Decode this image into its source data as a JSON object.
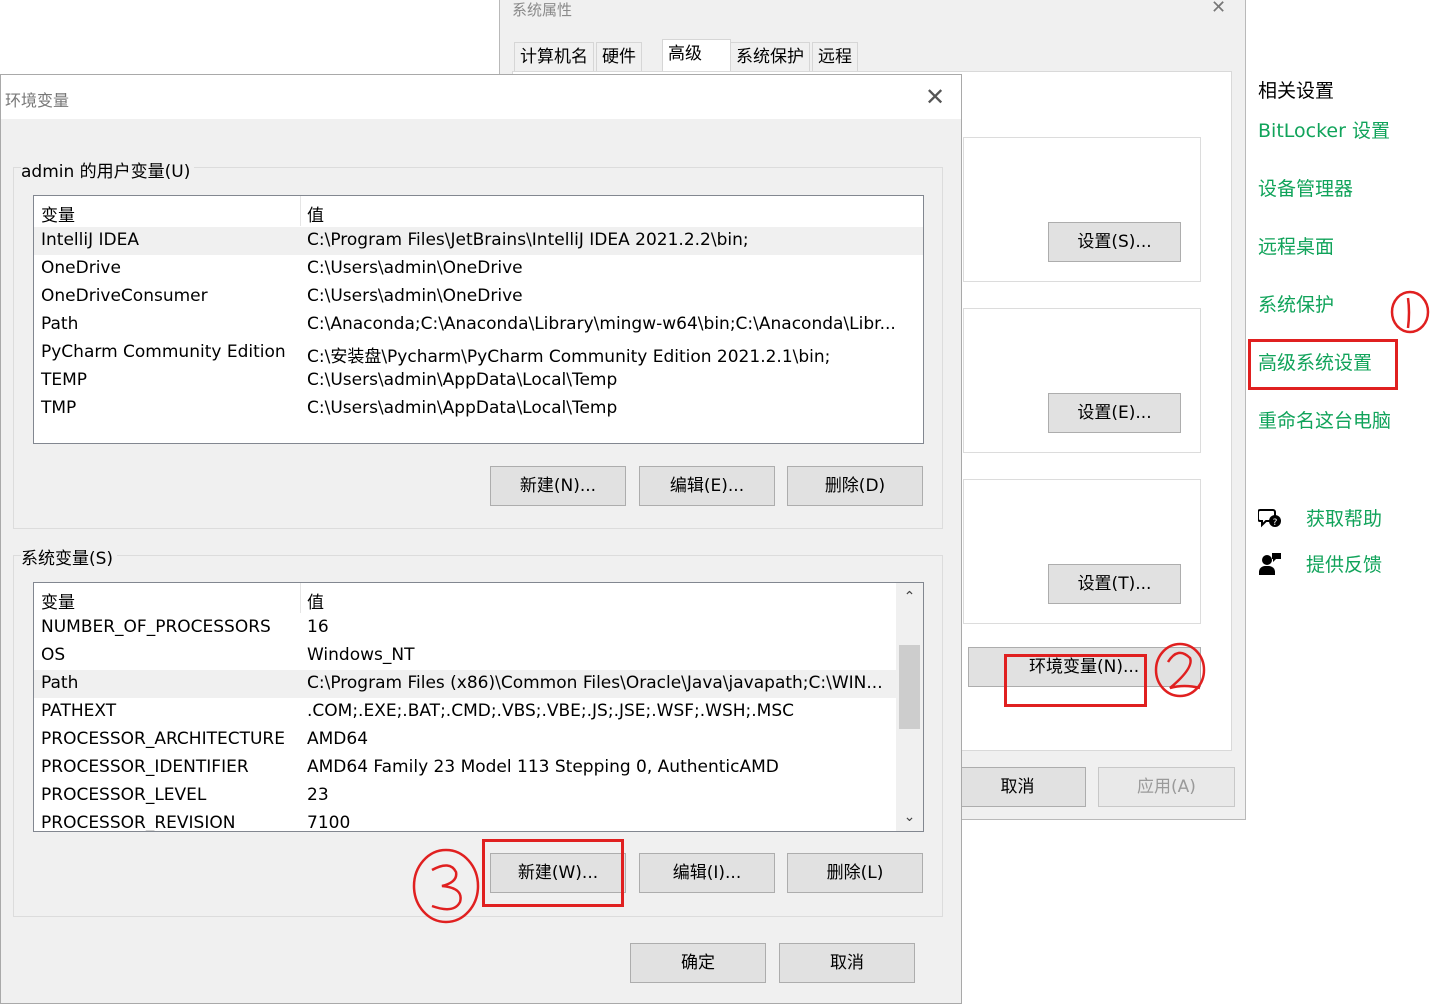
{
  "settings_panel": {
    "title": "相关设置",
    "links": [
      "BitLocker 设置",
      "设备管理器",
      "远程桌面",
      "系统保护",
      "高级系统设置",
      "重命名这台电脑"
    ],
    "help": [
      {
        "label": "获取帮助",
        "icon": "chat-help-icon"
      },
      {
        "label": "提供反馈",
        "icon": "feedback-person-icon"
      }
    ],
    "link_color": "#10a35a"
  },
  "system_properties": {
    "title": "系统属性",
    "tabs": [
      "计算机名",
      "硬件",
      "高级",
      "系统保护",
      "远程"
    ],
    "active_tab": "高级",
    "buttons": {
      "performance_settings": "设置(S)...",
      "profile_settings": "设置(E)...",
      "startup_settings": "设置(T)...",
      "env_vars": "环境变量(N)...",
      "cancel": "取消",
      "apply": "应用(A)"
    }
  },
  "env_dialog": {
    "title": "环境变量",
    "user_section": {
      "legend": "admin 的用户变量(U)",
      "columns": [
        "变量",
        "值"
      ],
      "rows": [
        {
          "name": "IntelliJ IDEA",
          "value": "C:\\Program Files\\JetBrains\\IntelliJ IDEA 2021.2.2\\bin;"
        },
        {
          "name": "OneDrive",
          "value": "C:\\Users\\admin\\OneDrive"
        },
        {
          "name": "OneDriveConsumer",
          "value": "C:\\Users\\admin\\OneDrive"
        },
        {
          "name": "Path",
          "value": "C:\\Anaconda;C:\\Anaconda\\Library\\mingw-w64\\bin;C:\\Anaconda\\Libr..."
        },
        {
          "name": "PyCharm Community Edition",
          "value": "C:\\安装盘\\Pycharm\\PyCharm Community Edition 2021.2.1\\bin;"
        },
        {
          "name": "TEMP",
          "value": "C:\\Users\\admin\\AppData\\Local\\Temp"
        },
        {
          "name": "TMP",
          "value": "C:\\Users\\admin\\AppData\\Local\\Temp"
        }
      ],
      "buttons": {
        "new": "新建(N)...",
        "edit": "编辑(E)...",
        "delete": "删除(D)"
      }
    },
    "system_section": {
      "legend": "系统变量(S)",
      "columns": [
        "变量",
        "值"
      ],
      "rows": [
        {
          "name": "NUMBER_OF_PROCESSORS",
          "value": "16"
        },
        {
          "name": "OS",
          "value": "Windows_NT"
        },
        {
          "name": "Path",
          "value": "C:\\Program Files (x86)\\Common Files\\Oracle\\Java\\javapath;C:\\WIN..."
        },
        {
          "name": "PATHEXT",
          "value": ".COM;.EXE;.BAT;.CMD;.VBS;.VBE;.JS;.JSE;.WSF;.WSH;.MSC"
        },
        {
          "name": "PROCESSOR_ARCHITECTURE",
          "value": "AMD64"
        },
        {
          "name": "PROCESSOR_IDENTIFIER",
          "value": "AMD64 Family 23 Model 113 Stepping 0, AuthenticAMD"
        },
        {
          "name": "PROCESSOR_LEVEL",
          "value": "23"
        },
        {
          "name": "PROCESSOR_REVISION",
          "value": "7100"
        }
      ],
      "buttons": {
        "new": "新建(W)...",
        "edit": "编辑(I)...",
        "delete": "删除(L)"
      }
    },
    "ok": "确定",
    "cancel": "取消"
  },
  "annotations": {
    "color": "#e02020",
    "steps": [
      "1",
      "2",
      "3"
    ]
  }
}
